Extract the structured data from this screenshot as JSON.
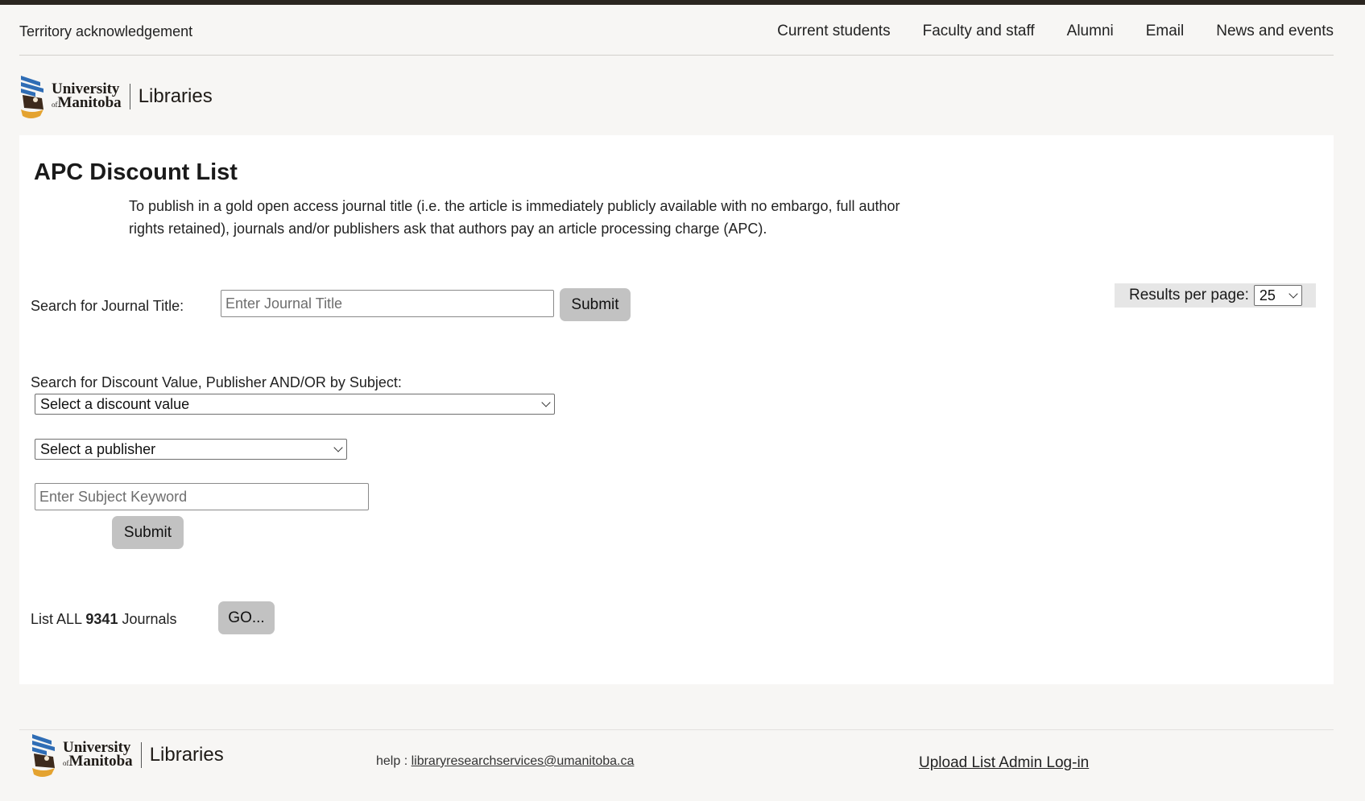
{
  "utility": {
    "territory": "Territory acknowledgement",
    "nav": [
      "Current students",
      "Faculty and staff",
      "Alumni",
      "Email",
      "News and events"
    ]
  },
  "logo": {
    "line1": "University",
    "prefix": "of",
    "line2": "Manitoba",
    "libraries": "Libraries"
  },
  "main": {
    "title": "APC Discount List",
    "intro": "To publish in a gold open access journal title (i.e. the article is immediately publicly available with no embargo, full author rights retained), journals and/or publishers ask that authors pay an article processing charge (APC).",
    "title_search": {
      "label": "Search for Journal Title:",
      "placeholder": "Enter Journal Title",
      "submit": "Submit"
    },
    "results_per_page": {
      "label": "Results per page:",
      "value": "25"
    },
    "filter": {
      "label": "Search for Discount Value, Publisher AND/OR by Subject:",
      "discount_select": "Select a discount value",
      "publisher_select": "Select a publisher",
      "subject_placeholder": "Enter Subject Keyword",
      "submit": "Submit"
    },
    "list_all": {
      "prefix": "List ALL",
      "count": "9341",
      "suffix": "Journals",
      "button": "GO..."
    }
  },
  "footer": {
    "help_label": "help :",
    "help_email": "libraryresearchservices@umanitoba.ca",
    "admin_link": "Upload List Admin Log-in"
  },
  "colors": {
    "page_bg": "#f7f6f4",
    "top_bar": "#2b2620",
    "button_bg": "#c2c2c2",
    "logo_blue": "#2f6db5",
    "logo_gold": "#e4a330",
    "logo_brown": "#3d2a1c"
  }
}
